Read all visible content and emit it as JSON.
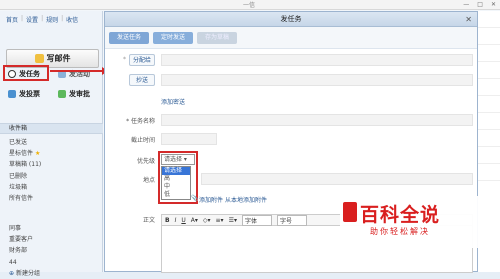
{
  "topbar": {
    "title": "一信",
    "btn_min": "—",
    "btn_max": "□",
    "btn_close": "✕"
  },
  "sidebar": {
    "nav": [
      "首页",
      "设置",
      "规则",
      "收信"
    ],
    "compose_label": "写邮件",
    "actions": {
      "task": "发任务",
      "activity": "发活动",
      "vote": "发投票",
      "approval": "发审批"
    },
    "folders_title": "收件箱",
    "folders": [
      "已发送",
      "星标信件",
      "草稿箱 (11)",
      "已删除",
      "垃圾箱",
      "所有信件"
    ],
    "groups": [
      "同事",
      "重要客户",
      "财务部",
      "44",
      "新建分组"
    ]
  },
  "dialog": {
    "title": "发任务",
    "close": "✕",
    "toolbar": {
      "send": "发送任务",
      "scheduled": "定时发送",
      "draft": "存为草稿"
    },
    "assignee_btn": "分配给",
    "cc_btn": "抄送",
    "add_bcc": "添加密送",
    "task_name_label": "* 任务名称",
    "deadline_label": "截止时间",
    "priority_label": "优先级",
    "priority_value": "请选择 ▾",
    "priority_options": [
      "请选择",
      "高",
      "中",
      "低"
    ],
    "location_label": "地点",
    "attach_link": "添加附件",
    "local_attach_link": "从本地添加附件",
    "body_label": "正文",
    "editor": {
      "bold": "B",
      "italic": "I",
      "underline": "U",
      "font": "字体",
      "size": "字号"
    }
  },
  "watermark": {
    "title": "百科全说",
    "subtitle": "助你轻松解决"
  },
  "colors": {
    "accent": "#7ea6d6",
    "highlight": "#d42a2a"
  }
}
